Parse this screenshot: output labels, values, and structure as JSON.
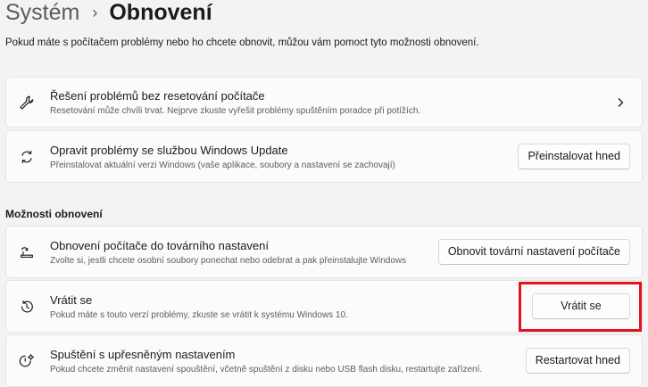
{
  "breadcrumb": {
    "parent": "Systém",
    "separator": "›",
    "current": "Obnovení"
  },
  "intro": "Pokud máte s počítačem problémy nebo ho chcete obnovit, můžou vám pomoct tyto možnosti obnovení.",
  "cards": {
    "troubleshoot": {
      "icon": "wrench-icon",
      "title": "Řešení problémů bez resetování počítače",
      "desc": "Resetování může chvíli trvat. Nejprve zkuste vyřešit problémy spuštěním poradce při potížích."
    },
    "windows_update": {
      "icon": "sync-icon",
      "title": "Opravit problémy se službou Windows Update",
      "desc": "Přeinstalovat aktuální verzi Windows (vaše aplikace, soubory a nastavení se zachovají)",
      "button": "Přeinstalovat hned"
    }
  },
  "section_title": "Možnosti obnovení",
  "options": {
    "reset": {
      "icon": "reset-pc-icon",
      "title": "Obnovení počítače do továrního nastavení",
      "desc": "Zvolte si, jestli chcete osobní soubory ponechat nebo odebrat a pak přeinstalujte Windows",
      "button": "Obnovit tovární nastavení počítače"
    },
    "go_back": {
      "icon": "history-icon",
      "title": "Vrátit se",
      "desc": "Pokud máte s touto verzí problémy, zkuste se vrátit k systému Windows 10.",
      "button": "Vrátit se"
    },
    "advanced": {
      "icon": "advanced-startup-icon",
      "title": "Spuštění s upřesněným nastavením",
      "desc": "Pokud chcete změnit nastavení spouštění, včetně spuštění z disku nebo USB flash disku, restartujte zařízení.",
      "button": "Restartovat hned"
    }
  },
  "colors": {
    "highlight": "#e3121f",
    "background": "#f3f3f3",
    "card": "#fbfbfb"
  }
}
